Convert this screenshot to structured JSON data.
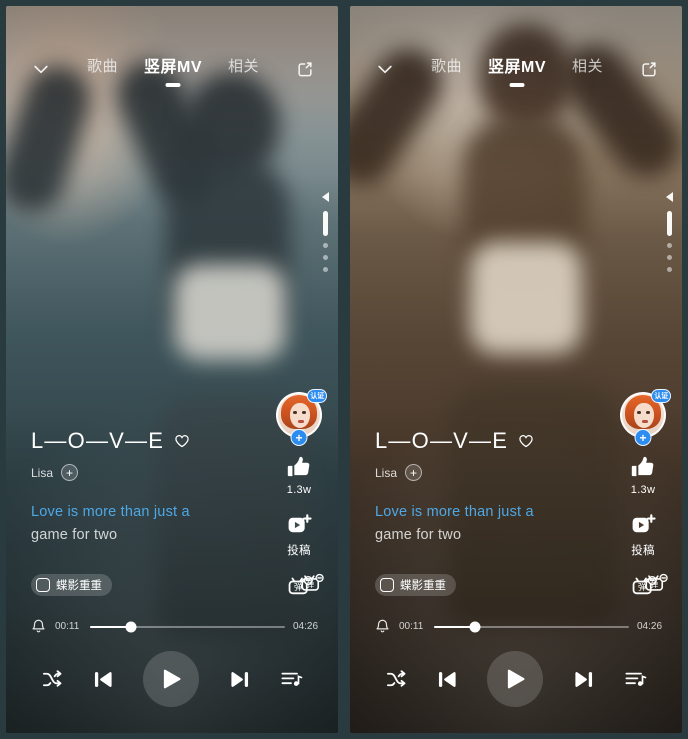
{
  "app": {
    "screen_name": "vertical-mv-player",
    "variant_count": 2
  },
  "topbar": {
    "collapse_icon": "chevron-down-icon",
    "share_icon": "share-icon",
    "tabs": [
      {
        "label": "歌曲",
        "active": false
      },
      {
        "label": "竖屏MV",
        "active": true
      },
      {
        "label": "相关",
        "active": false
      }
    ]
  },
  "pager": {
    "caret_icon": "caret-left-icon",
    "dots": 3,
    "active_index": 0
  },
  "rail": {
    "avatar": {
      "name": "artist-avatar",
      "badge": "认证",
      "follow_label": "+"
    },
    "like": {
      "icon": "thumbs-up-icon",
      "count": "1.3w"
    },
    "contribute": {
      "icon": "video-plus-icon",
      "label": "投稿"
    },
    "danmaku": {
      "icon": "danmaku-off-icon"
    }
  },
  "meta": {
    "title": "L—O—V—E",
    "favorite_icon": "heart-outline-icon",
    "artist": "Lisa",
    "follow_label": "+",
    "lyric_current": "Love is more than just a",
    "lyric_next": "game for two"
  },
  "tag": {
    "icon": "square-badge-icon",
    "label": "蝶影重重"
  },
  "progress": {
    "bell_icon": "alarm-bell-icon",
    "current_time": "00:11",
    "total_time": "04:26",
    "percent": 21
  },
  "controls": {
    "shuffle": {
      "icon": "shuffle-icon",
      "name": "shuffle-button"
    },
    "previous": {
      "icon": "skip-previous-icon",
      "name": "previous-button"
    },
    "play": {
      "icon": "play-icon",
      "name": "play-button"
    },
    "next": {
      "icon": "skip-next-icon",
      "name": "next-button"
    },
    "playlist": {
      "icon": "playlist-music-icon",
      "name": "playlist-button"
    }
  },
  "colors": {
    "accent_lyric": "#4ea8e6",
    "badge_blue": "#2d8cf0",
    "text_primary": "#ffffff"
  }
}
